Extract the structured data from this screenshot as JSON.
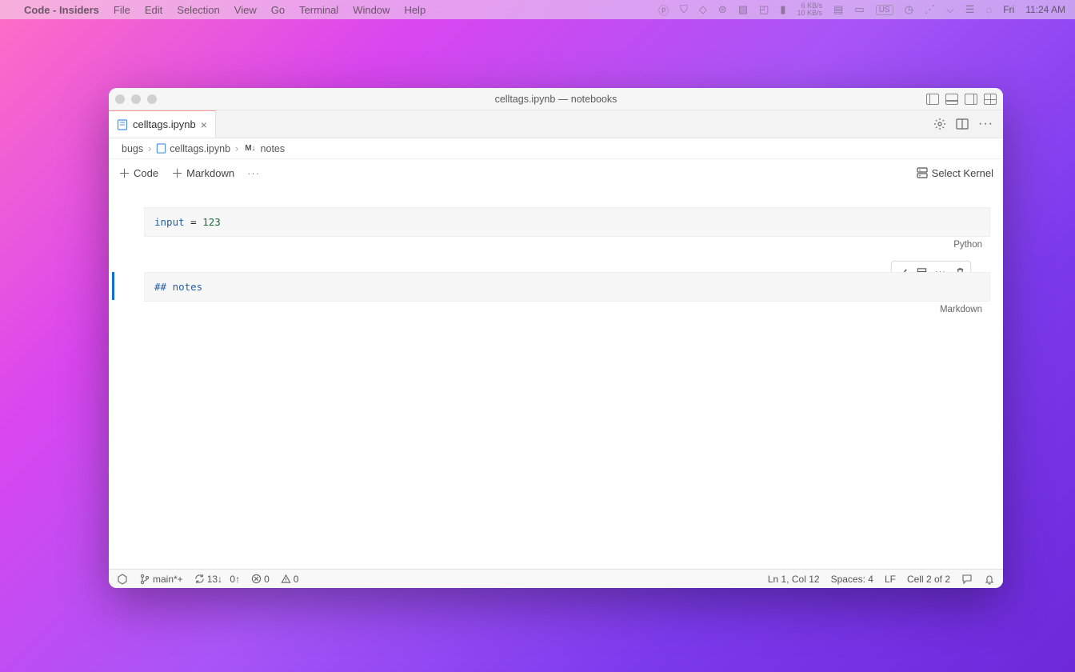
{
  "menubar": {
    "app": "Code - Insiders",
    "items": [
      "File",
      "Edit",
      "Selection",
      "View",
      "Go",
      "Terminal",
      "Window",
      "Help"
    ],
    "net_up": "6 KB/s",
    "net_down": "10 KB/s",
    "input_label": "US",
    "day": "Fri",
    "time": "11:24 AM"
  },
  "window": {
    "title": "celltags.ipynb — notebooks"
  },
  "tab": {
    "filename": "celltags.ipynb"
  },
  "breadcrumbs": {
    "root": "bugs",
    "file": "celltags.ipynb",
    "symbol": "notes",
    "symbol_prefix": "M↓"
  },
  "nb_toolbar": {
    "code": "Code",
    "markdown": "Markdown",
    "select_kernel": "Select Kernel"
  },
  "cells": [
    {
      "code_html": "<span class='kw'>input</span> <span class='op'>=</span> <span class='num'>123</span>",
      "lang": "Python"
    },
    {
      "code_html": "<span class='md'>## notes</span>",
      "lang": "Markdown"
    }
  ],
  "statusbar": {
    "branch": "main*+",
    "sync_down": "13↓",
    "sync_up": "0↑",
    "errors": "0",
    "warnings": "0",
    "cursor": "Ln 1, Col 12",
    "spaces": "Spaces: 4",
    "eol": "LF",
    "cell": "Cell 2 of 2"
  }
}
